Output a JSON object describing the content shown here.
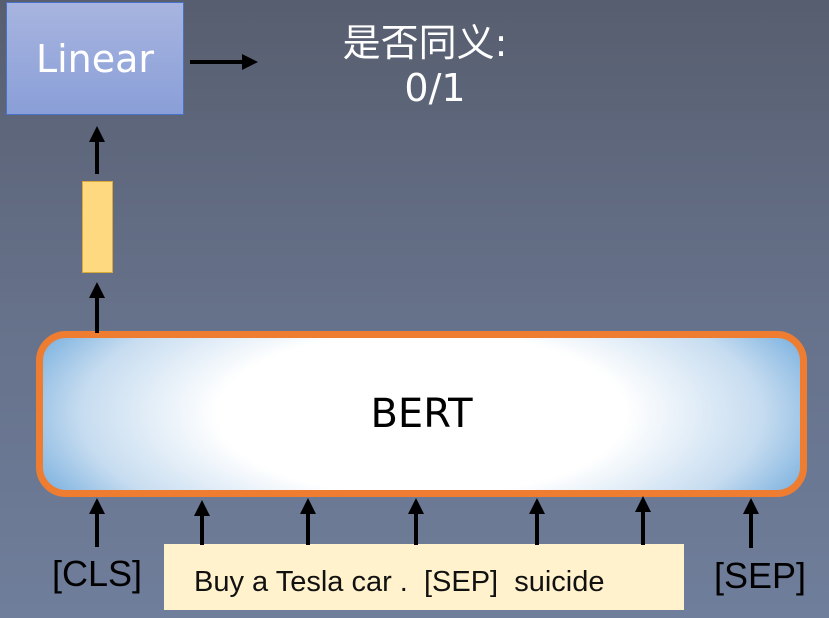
{
  "linear_label": "Linear",
  "output_label_line1": "是否同义:",
  "output_label_line2": "0/1",
  "bert_label": "BERT",
  "input_tokens": {
    "cls": "[CLS]",
    "sentence": "Buy a Tesla car .  [SEP]  suicide",
    "sep": "[SEP]"
  },
  "colors": {
    "bert_border": "#ee7d31",
    "linear_fill": "#8fa3d9",
    "vector_fill": "#ffd980",
    "sentence_bg": "#fff2cc"
  }
}
